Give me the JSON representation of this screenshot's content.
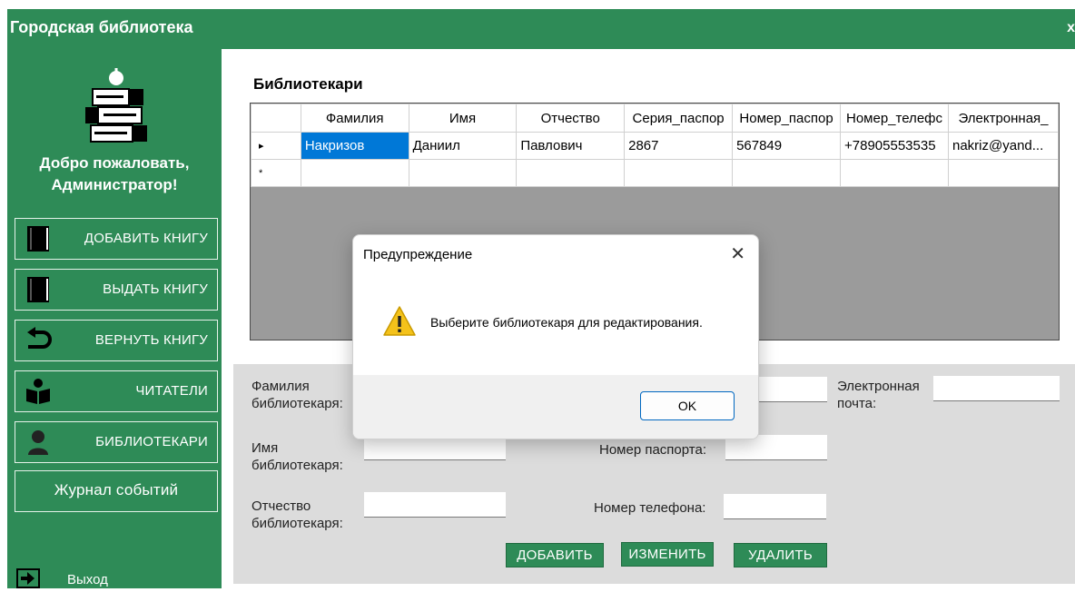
{
  "app": {
    "title": "Городская библиотека",
    "close_label": "x"
  },
  "sidebar": {
    "welcome_line1": "Добро пожаловать,",
    "welcome_line2": "Администратор!",
    "items": [
      {
        "label": "ДОБАВИТЬ КНИГУ",
        "icon": "book-icon"
      },
      {
        "label": "ВЫДАТЬ КНИГУ",
        "icon": "book-icon"
      },
      {
        "label": "ВЕРНУТЬ КНИГУ",
        "icon": "return-arrow-icon"
      },
      {
        "label": "ЧИТАТЕЛИ",
        "icon": "reader-icon"
      },
      {
        "label": "БИБЛИОТЕКАРИ",
        "icon": "user-icon"
      },
      {
        "label": "Журнал событий"
      }
    ],
    "exit_label": "Выход"
  },
  "main": {
    "section_title": "Библиотекари",
    "table": {
      "columns": [
        "Фамилия",
        "Имя",
        "Отчество",
        "Серия_паспор",
        "Номер_паспор",
        "Номер_телефс",
        "Электронная_"
      ],
      "rows": [
        [
          "Накризов",
          "Даниил",
          "Павлович",
          "2867",
          "567849",
          "+78905553535",
          "nakriz@yand..."
        ]
      ],
      "current_row_marker": "▸",
      "new_row_marker": "*"
    }
  },
  "form": {
    "last_name_label": "Фамилия библиотекаря:",
    "first_name_label": "Имя библиотекаря:",
    "patronymic_label": "Отчество библиотекаря:",
    "passport_number_label": "Номер паспорта:",
    "phone_label": "Номер телефона:",
    "email_label": "Электронная почта:",
    "add_button": "ДОБАВИТЬ",
    "edit_button": "ИЗМЕНИТЬ",
    "delete_button": "УДАЛИТЬ"
  },
  "dialog": {
    "title": "Предупреждение",
    "message": "Выберите библиотекаря для редактирования.",
    "ok_label": "OK",
    "icon": "warning-icon"
  },
  "colors": {
    "primary": "#2e8b57",
    "selection": "#0078d7",
    "grid_bg": "#9b9b9b",
    "form_bg": "#dcdcdc"
  }
}
